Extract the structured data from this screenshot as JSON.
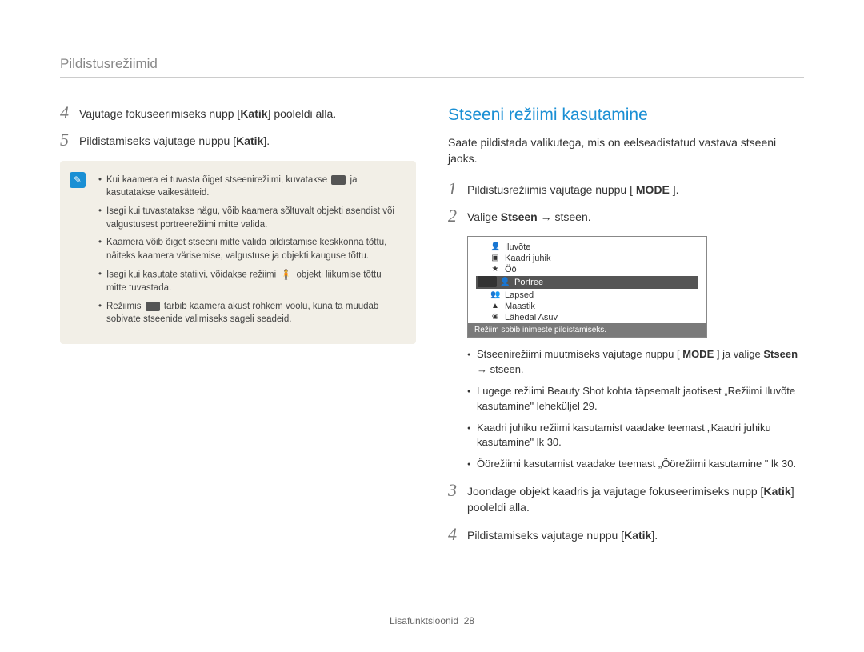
{
  "section_header": "Pildistusrežiimid",
  "left": {
    "step4": {
      "num": "4",
      "prefix": "Vajutage fokuseerimiseks nupp [",
      "bold": "Katik",
      "suffix": "] pooleldi alla."
    },
    "step5": {
      "num": "5",
      "prefix": "Pildistamiseks vajutage nuppu [",
      "bold": "Katik",
      "suffix": "]."
    },
    "notes": {
      "n1a": "Kui kaamera ei tuvasta õiget stseenirežiimi, kuvatakse ",
      "n1b": " ja kasutatakse vaikesätteid.",
      "n2": "Isegi kui tuvastatakse nägu, võib kaamera sõltuvalt objekti asendist või valgustusest portreerežiimi mitte valida.",
      "n3": "Kaamera võib õiget stseeni mitte valida pildistamise keskkonna tõttu, näiteks kaamera värisemise, valgustuse ja objekti kauguse tõttu.",
      "n4a": "Isegi kui kasutate statiivi, võidakse režiimi ",
      "n4b": " objekti liikumise tõttu mitte tuvastada.",
      "n5a": "Režiimis ",
      "n5b": " tarbib kaamera akust rohkem voolu, kuna ta muudab sobivate stseenide valimiseks sageli seadeid."
    }
  },
  "right": {
    "heading": "Stseeni režiimi kasutamine",
    "intro": "Saate pildistada valikutega, mis on eelseadistatud vastava stseeni jaoks.",
    "step1": {
      "num": "1",
      "prefix": "Pildistusrežiimis vajutage nuppu [ ",
      "bold": "MODE",
      "suffix": " ]."
    },
    "step2": {
      "num": "2",
      "prefix": "Valige ",
      "bold": "Stseen",
      "arrow": " → ",
      "suffix": "stseen."
    },
    "camera": {
      "rows": [
        {
          "icon": "👤",
          "label": "Iluvõte"
        },
        {
          "icon": "▣",
          "label": "Kaadri juhik"
        },
        {
          "icon": "★",
          "label": "Öö"
        },
        {
          "icon": "👤",
          "label": "Portree",
          "highlight": true
        },
        {
          "icon": "👥",
          "label": "Lapsed"
        },
        {
          "icon": "▲",
          "label": "Maastik"
        },
        {
          "icon": "❀",
          "label": "Lähedal Asuv"
        }
      ],
      "meta": "Režiim sobib inimeste pildistamiseks."
    },
    "bullets": {
      "b1a": "Stseenirežiimi muutmiseks vajutage nuppu [ ",
      "b1_mode": "MODE",
      "b1b": " ] ja valige ",
      "b1_bold": "Stseen",
      "b1_arrow": " → ",
      "b1c": "stseen.",
      "b2": "Lugege režiimi Beauty Shot kohta täpsemalt jaotisest „Režiimi Iluvõte kasutamine\" leheküljel 29.",
      "b3": "Kaadri juhiku režiimi kasutamist vaadake teemast „Kaadri juhiku kasutamine\" lk 30.",
      "b4": "Öörežiimi kasutamist vaadake teemast „Öörežiimi kasutamine \" lk 30."
    },
    "step3": {
      "num": "3",
      "prefix": "Joondage objekt kaadris ja vajutage fokuseerimiseks nupp [",
      "bold": "Katik",
      "suffix": "] pooleldi alla."
    },
    "step4": {
      "num": "4",
      "prefix": "Pildistamiseks vajutage nuppu [",
      "bold": "Katik",
      "suffix": "]."
    }
  },
  "footer": {
    "label": "Lisafunktsioonid",
    "page": "28"
  }
}
